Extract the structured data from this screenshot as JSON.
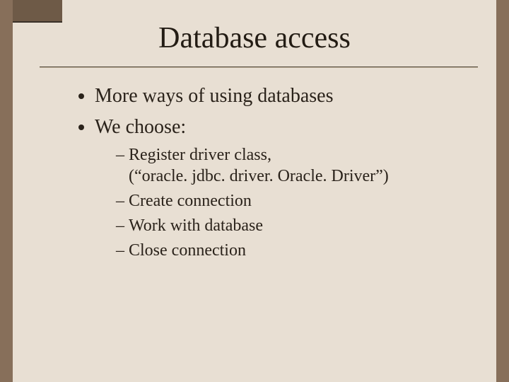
{
  "slide": {
    "title": "Database access",
    "bullets": {
      "b1": "More ways of using databases",
      "b2": "We choose:"
    },
    "sub": {
      "s1_line1": "Register driver class,",
      "s1_line2": "(“oracle. jdbc. driver. Oracle. Driver”)",
      "s2": "Create connection",
      "s3": "Work with database",
      "s4": "Close connection"
    }
  }
}
